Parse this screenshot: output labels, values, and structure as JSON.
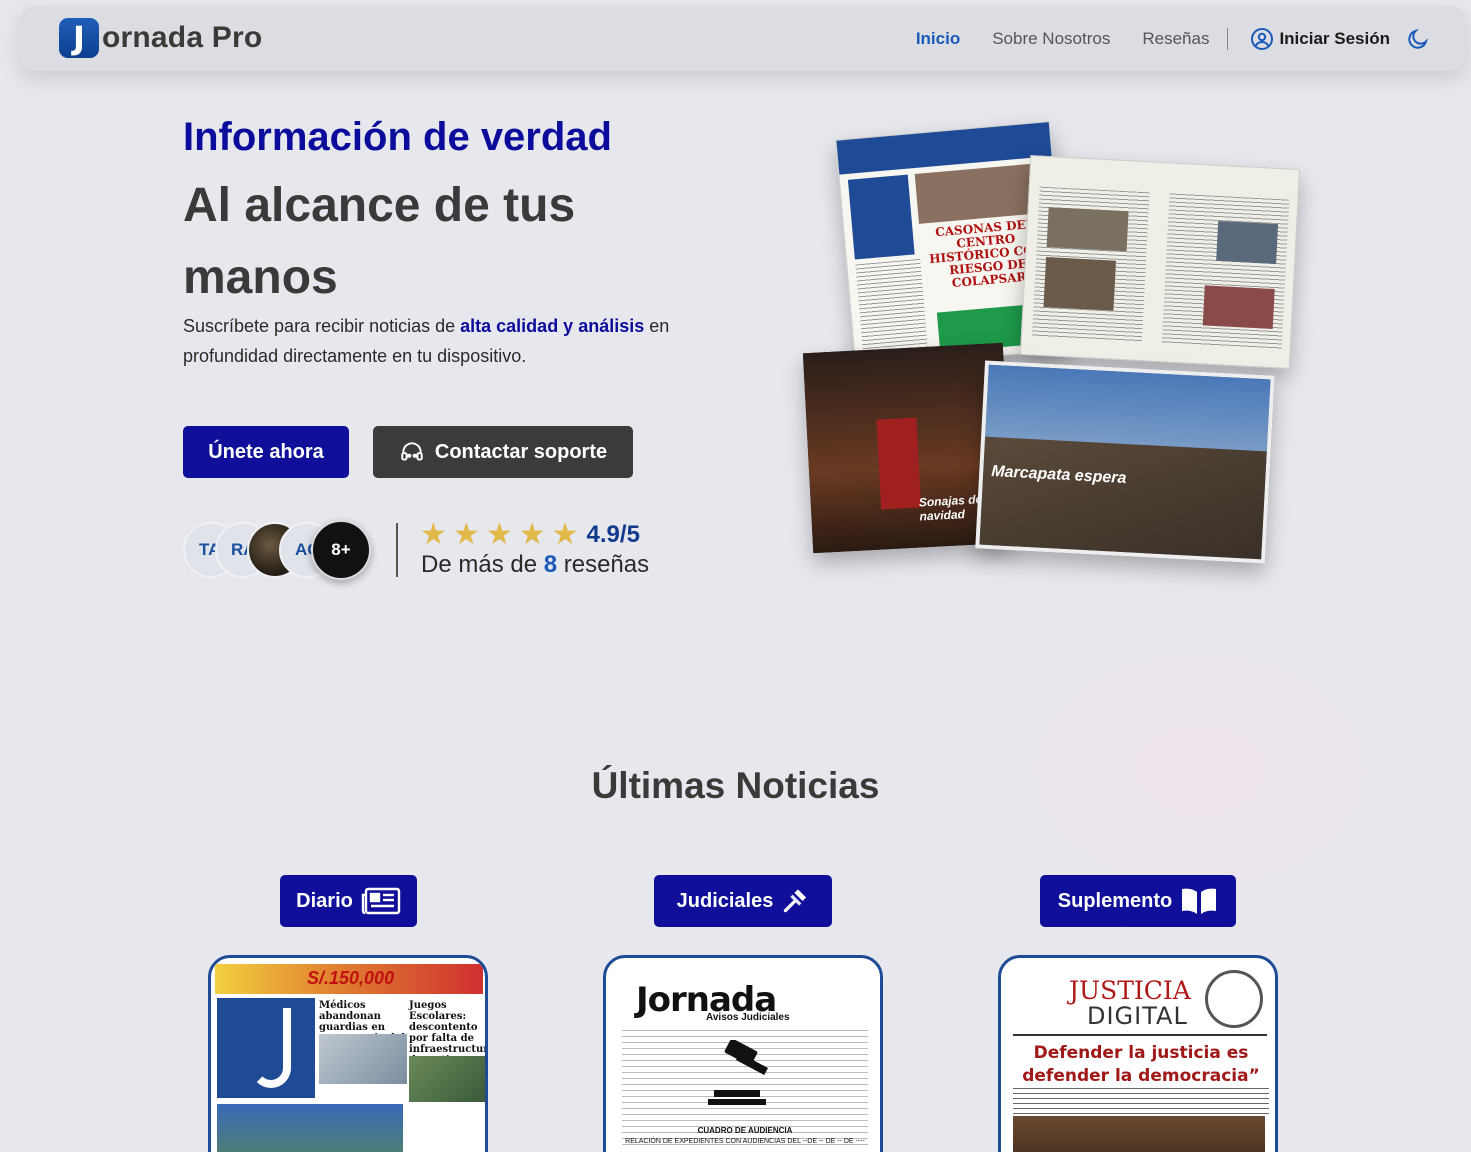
{
  "header": {
    "logo_letter": "J",
    "logo_text": "ornada Pro",
    "nav": [
      "Inicio",
      "Sobre Nosotros",
      "Reseñas"
    ],
    "login_label": "Iniciar Sesión"
  },
  "hero": {
    "title": "Información de verdad",
    "subtitle": "Al alcance de tus manos",
    "desc_before": "Suscríbete para recibir noticias de ",
    "desc_highlight": "alta calidad y análisis",
    "desc_after": " en profundidad directamente en tu dispositivo.",
    "join_label": "Únete ahora",
    "support_label": "Contactar soporte",
    "avatars": [
      "TA",
      "RA",
      "",
      "AC"
    ],
    "avatars_more": "8+",
    "rating": "4.9/5",
    "reviews_prefix": "De más de ",
    "reviews_count": "8",
    "reviews_suffix": " reseñas"
  },
  "collage": {
    "np1_headline": "CASONAS DEL CENTRO HISTÓRICO CON RIESGO DE COLAPSAR",
    "np3_caption": "Sonajas de navidad",
    "np4_caption": "Marcapata espera"
  },
  "news": {
    "title": "Últimas Noticias",
    "categories": [
      "Diario",
      "Judiciales",
      "Suplemento"
    ],
    "diario": {
      "banner": "S/.150,000",
      "head1": "Médicos abandonan guardias en emergencia del HRA",
      "head2": "Juegos Escolares: descontento por falta de infraestructura deportiva"
    },
    "judiciales": {
      "logo": "Jornada",
      "sub": "Avisos Judiciales",
      "table_title": "CUADRO DE AUDIENCIA",
      "table_sub": "RELACIÓN DE EXPEDIENTES CON AUDIENCIAS DEL --DE -- DE -- DE ----"
    },
    "suplemento": {
      "title1": "JUSTICIA",
      "title2": "DIGITAL",
      "headline": "Defender la justicia es defender la democracia”"
    }
  },
  "colors": {
    "brand": "#0f0f99",
    "accent": "#1a5ab8",
    "dark_button": "#3b3b3b",
    "star": "#e1b84a"
  }
}
